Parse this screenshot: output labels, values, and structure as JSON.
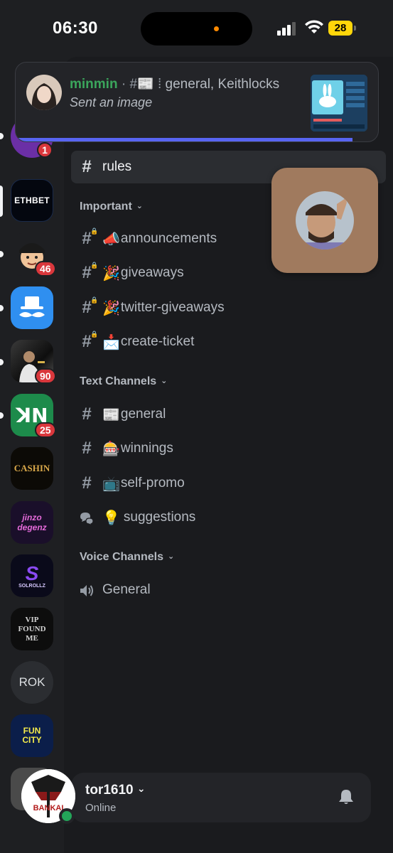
{
  "status_bar": {
    "time": "06:30",
    "battery": "28"
  },
  "notification": {
    "username": "minmin",
    "separator": "·",
    "channel_prefix": "#",
    "channel_emoji": "📰",
    "context": "general, Keithlocks",
    "message": "Sent an image",
    "progress": 0.93
  },
  "servers": [
    {
      "name": "purple-server",
      "badge": "1"
    },
    {
      "name": "ETHBET",
      "label": "ETHBET"
    },
    {
      "name": "avatar-server",
      "badge": "46"
    },
    {
      "name": "mustache-server"
    },
    {
      "name": "photo-server",
      "badge": "90"
    },
    {
      "name": "kn-server",
      "badge": "25"
    },
    {
      "name": "CASHIN",
      "label": "CASHIN"
    },
    {
      "name": "jinzo-degenz",
      "label": "jinzo degenz"
    },
    {
      "name": "SOLROLLZ",
      "label": "SOLROLLZ"
    },
    {
      "name": "VIP FOUND ME",
      "label": "VIP FOUND ME"
    },
    {
      "name": "ROK",
      "label": "ROK"
    },
    {
      "name": "FUN CITY",
      "label": "FUN CITY"
    }
  ],
  "channels": {
    "selected": {
      "hash": "#",
      "name": "rules"
    },
    "categories": [
      {
        "name": "Important",
        "chevron": "⌄",
        "channels": [
          {
            "emoji": "📣",
            "name": "announcements",
            "locked": true
          },
          {
            "emoji": "🎉",
            "name": "giveaways",
            "locked": true
          },
          {
            "emoji": "🎉",
            "name": "twitter-giveaways",
            "locked": true
          },
          {
            "emoji": "📩",
            "name": "create-ticket",
            "locked": true
          }
        ]
      },
      {
        "name": "Text Channels",
        "chevron": "⌄",
        "channels": [
          {
            "emoji": "📰",
            "name": "general"
          },
          {
            "emoji": "🎰",
            "name": "winnings"
          },
          {
            "emoji": "📺",
            "name": "self-promo"
          },
          {
            "emoji": "💡",
            "name": "suggestions",
            "type": "forum"
          }
        ]
      },
      {
        "name": "Voice Channels",
        "chevron": "⌄",
        "channels": [
          {
            "name": "General",
            "type": "voice"
          }
        ]
      }
    ]
  },
  "user_panel": {
    "username": "tor1610",
    "chevron": "⌄",
    "status": "Online",
    "avatar_text": "BANKAI"
  },
  "colors": {
    "accent": "#5865f2",
    "online": "#23a559",
    "badge": "#da373c",
    "username_green": "#3ba55c"
  }
}
